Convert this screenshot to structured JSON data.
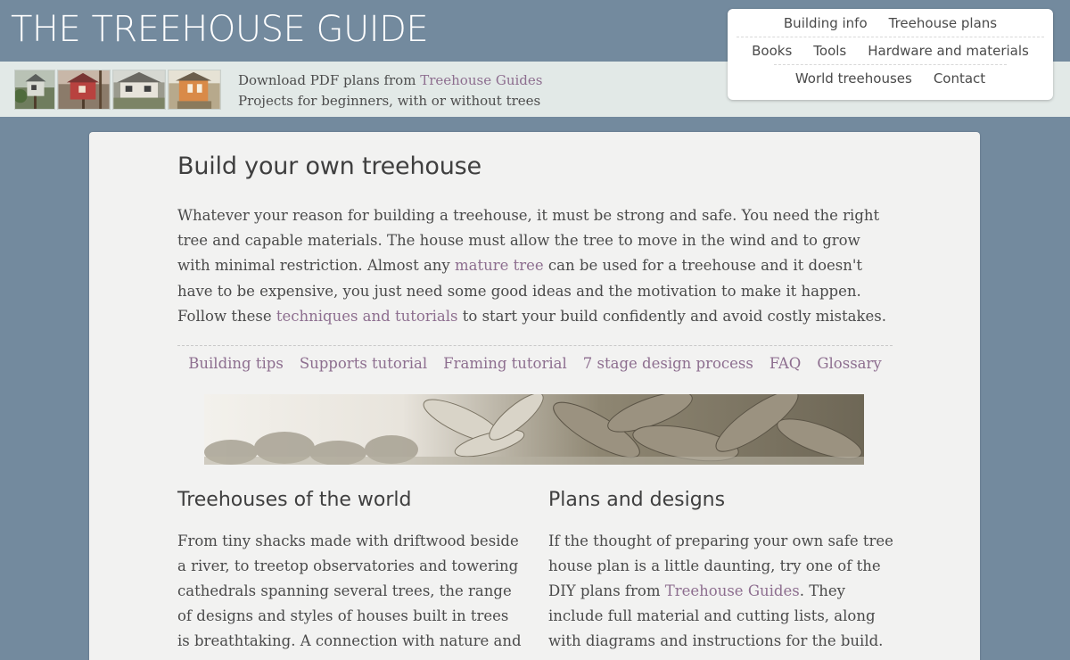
{
  "header": {
    "site_title": "THE TREEHOUSE GUIDE",
    "banner_line1_prefix": "Download PDF plans from ",
    "banner_line1_link": "Treehouse Guides",
    "banner_line2": "Projects for beginners, with or without trees"
  },
  "nav": {
    "row1": [
      "Building info",
      "Treehouse plans"
    ],
    "row2": [
      "Books",
      "Tools",
      "Hardware and materials"
    ],
    "row3": [
      "World treehouses",
      "Contact"
    ]
  },
  "main": {
    "title": "Build your own treehouse",
    "intro_part1": "Whatever your reason for building a treehouse, it must be strong and safe. You need the right tree and capable materials. The house must allow the tree to move in the wind and to grow with minimal restriction. Almost any ",
    "intro_link1": "mature tree",
    "intro_part2": " can be used for a treehouse and it doesn't have to be expensive, you just need some good ideas and the motivation to make it happen. Follow these ",
    "intro_link2": "techniques and tutorials",
    "intro_part3": " to start your build confidently and avoid costly mistakes.",
    "sub_links": [
      "Building tips",
      "Supports tutorial",
      "Framing tutorial",
      "7 stage design process",
      "FAQ",
      "Glossary"
    ]
  },
  "columns": {
    "left": {
      "heading": "Treehouses of the world",
      "text": "From tiny shacks made with driftwood beside a river, to treetop observatories and towering cathedrals spanning several trees, the range of designs and styles of houses built in trees is breathtaking. A connection with nature and"
    },
    "right": {
      "heading": "Plans and designs",
      "text_part1": "If the thought of preparing your own safe tree house plan is a little daunting, try one of the DIY plans from ",
      "text_link": "Treehouse Guides",
      "text_part2": ". They include full material and cutting lists, along with diagrams and instructions for the build."
    }
  },
  "colors": {
    "page_bg": "#738a9e",
    "banner_bg": "#e2e9e7",
    "link": "#8d6e8f",
    "card_bg": "#f2f2f1"
  }
}
